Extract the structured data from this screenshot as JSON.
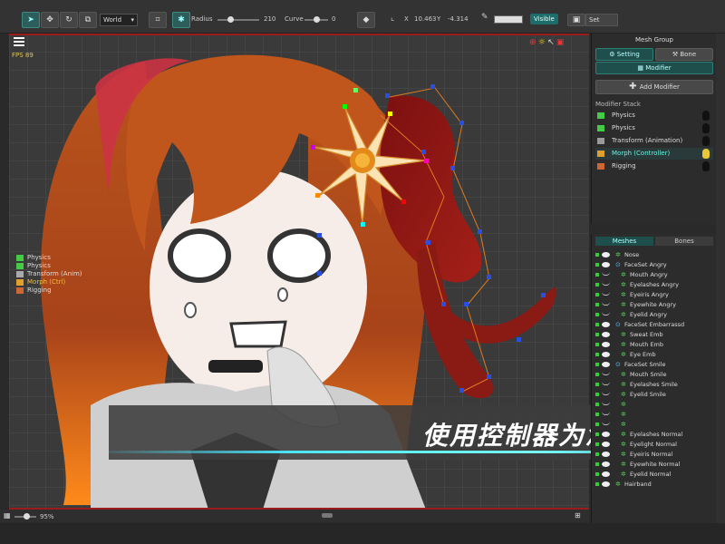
{
  "toolbar": {
    "world_select": "World",
    "radius_label": "Radius",
    "radius_value": "210",
    "radius_fraction": 0.3,
    "curve_label": "Curve",
    "curve_value": "0",
    "curve_fraction": 0.5,
    "x_label": "X",
    "x_value": "10.463",
    "y_label": "Y",
    "y_value": "-4.314",
    "visible_label": "Visible",
    "set_label": "Set"
  },
  "viewport": {
    "fps_text": "FPS 89",
    "modifiers": [
      {
        "label": "Physics",
        "color": "#4c4"
      },
      {
        "label": "Physics",
        "color": "#4c4"
      },
      {
        "label": "Transform (Anim)",
        "color": "#aaa"
      },
      {
        "label": "Morph (Ctrl)",
        "color": "#e0a030",
        "selected": true
      },
      {
        "label": "Rigging",
        "color": "#c63"
      }
    ]
  },
  "banner": {
    "text": "使用控制器为您的插图制"
  },
  "right_panel": {
    "title": "Mesh Group",
    "setting_label": "Setting",
    "bone_label": "Bone",
    "modifier_label": "Modifier",
    "add_modifier_label": "Add Modifier",
    "stack_title": "Modifier Stack",
    "stack": [
      {
        "label": "Physics"
      },
      {
        "label": "Physics"
      },
      {
        "label": "Transform (Animation)"
      },
      {
        "label": "Morph (Controller)",
        "selected": true
      },
      {
        "label": "Rigging"
      }
    ]
  },
  "mesh_panel": {
    "tab_meshes": "Meshes",
    "tab_bones": "Bones",
    "items": [
      {
        "label": "Nose",
        "indent": 0,
        "eye": "on"
      },
      {
        "label": "FaceSet Angry",
        "indent": 0,
        "eye": "on",
        "group": true
      },
      {
        "label": "Mouth Angry",
        "indent": 1,
        "eye": "off"
      },
      {
        "label": "Eyelashes Angry",
        "indent": 1,
        "eye": "off"
      },
      {
        "label": "Eyeiris Angry",
        "indent": 1,
        "eye": "off"
      },
      {
        "label": "Eyewhite Angry",
        "indent": 1,
        "eye": "off"
      },
      {
        "label": "Eyelid Angry",
        "indent": 1,
        "eye": "off"
      },
      {
        "label": "FaceSet Embarrassd",
        "indent": 0,
        "eye": "on",
        "group": true
      },
      {
        "label": "Sweat Emb",
        "indent": 1,
        "eye": "on"
      },
      {
        "label": "Mouth Emb",
        "indent": 1,
        "eye": "on"
      },
      {
        "label": "Eye Emb",
        "indent": 1,
        "eye": "on"
      },
      {
        "label": "FaceSet Smile",
        "indent": 0,
        "eye": "on",
        "group": true
      },
      {
        "label": "Mouth Smile",
        "indent": 1,
        "eye": "off"
      },
      {
        "label": "Eyelashes Smile",
        "indent": 1,
        "eye": "off"
      },
      {
        "label": "Eyelid Smile",
        "indent": 1,
        "eye": "off"
      },
      {
        "label": "",
        "indent": 1,
        "eye": "off"
      },
      {
        "label": "",
        "indent": 1,
        "eye": "off"
      },
      {
        "label": "",
        "indent": 1,
        "eye": "off"
      },
      {
        "label": "Eyelashes Normal",
        "indent": 1,
        "eye": "on"
      },
      {
        "label": "Eyelight Normal",
        "indent": 1,
        "eye": "on"
      },
      {
        "label": "Eyeiris Normal",
        "indent": 1,
        "eye": "on"
      },
      {
        "label": "Eyewhite Normal",
        "indent": 1,
        "eye": "on"
      },
      {
        "label": "Eyelid Normal",
        "indent": 1,
        "eye": "on"
      },
      {
        "label": "Hairband",
        "indent": 0,
        "eye": "on"
      }
    ]
  },
  "status": {
    "zoom": "95%"
  }
}
